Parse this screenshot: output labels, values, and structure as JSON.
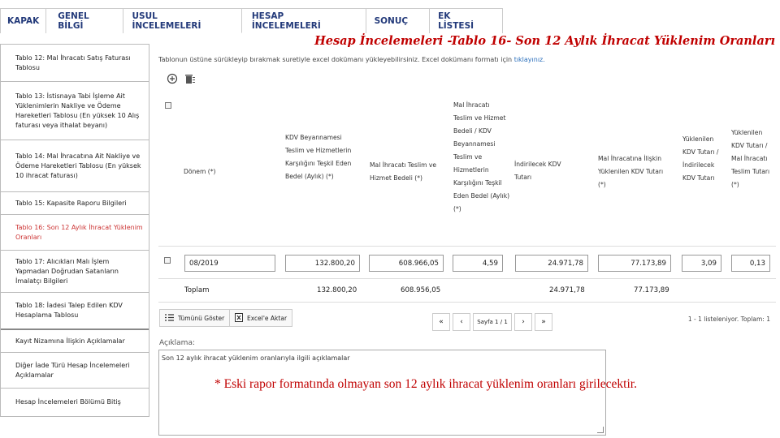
{
  "tabs": [
    "KAPAK",
    "GENEL BİLGİ",
    "USUL İNCELEMELERİ",
    "HESAP İNCELEMELERİ",
    "SONUÇ",
    "EK LİSTESİ"
  ],
  "active_tab": 3,
  "slide_title": "Hesap İncelemeleri -Tablo 16- Son 12 Aylık İhracat Yüklenim Oranları",
  "sidebar": {
    "items": [
      {
        "label": "Tablo 12: Mal İhracatı Satış Faturası Tablosu"
      },
      {
        "label": "Tablo 13: İstisnaya Tabi İşleme Ait Yüklenimlerin Nakliye ve Ödeme Hareketleri Tablosu (En yüksek 10 Alış faturası veya ithalat beyanı)"
      },
      {
        "label": "Tablo 14: Mal İhracatına Ait Nakliye ve Ödeme Hareketleri Tablosu (En yüksek 10 ihracat faturası)"
      },
      {
        "label": "Tablo 15: Kapasite Raporu Bilgileri"
      },
      {
        "label": "Tablo 16: Son 12 Aylık İhracat Yüklenim Oranları"
      },
      {
        "label": "Tablo 17: Alıcıkları Malı İşlem Yapmadan Doğrudan Satanların İmalatçı Bilgileri"
      },
      {
        "label": "Tablo 18: İadesi Talep Edilen KDV Hesaplama Tablosu"
      },
      {
        "label": "Kayıt Nizamına İlişkin Açıklamalar"
      },
      {
        "label": "Diğer İade Türü Hesap İncelemeleri Açıklamalar"
      },
      {
        "label": "Hesap İncelemeleri Bölümü Bitiş"
      }
    ]
  },
  "drag_hint": {
    "text": "Tablonun üstüne sürükleyip bırakmak suretiyle excel dokümanı yükleyebilirsiniz. Excel dokümanı formatı için",
    "link": "tıklayınız."
  },
  "icons": [
    "add-icon",
    "delete-all-icon"
  ],
  "columns": [
    "Dönem (*)",
    "KDV Beyannamesi Teslim ve Hizmetlerin Karşılığını Teşkil Eden Bedel (Aylık) (*)",
    "Mal İhracatı Teslim ve Hizmet Bedeli (*)",
    "Mal İhracatı Teslim ve Hizmet Bedeli / KDV Beyannamesi Teslim ve Hizmetlerin Karşılığını Teşkil Eden Bedel (Aylık) (*)",
    "İndirilecek KDV Tutarı",
    "Mal İhracatına İlişkin Yüklenilen KDV Tutarı (*)",
    "Yüklenilen KDV Tutarı / İndirilecek KDV Tutarı",
    "Yüklenilen KDV Tutarı / Mal İhracatı Teslim Tutarı (*)"
  ],
  "row": [
    "08/2019",
    "132.800,20",
    "608.966,05",
    "4,59",
    "24.971,78",
    "77.173,89",
    "3,09",
    "0,13"
  ],
  "totals": {
    "label": "Toplam",
    "values": [
      "132.800,20",
      "608.956,05",
      "24.971,78",
      "77.173,89"
    ]
  },
  "toolbar": {
    "show_all": "Tümünü Göster",
    "export_excel": "Excel'e Aktar"
  },
  "pager": {
    "first": "«",
    "prev": "‹",
    "page_label": "Sayfa 1 / 1",
    "next": "›",
    "last": "»",
    "info": "1 - 1 listeleniyor. Toplam: 1"
  },
  "description": {
    "label": "Açıklama:",
    "value": "Son 12 aylık ihracat yüklenim oranlarıyla ilgili açıklamalar"
  },
  "note": "* Eski rapor formatında olmayan son 12 aylık ihracat yüklenim oranları girilecektir."
}
